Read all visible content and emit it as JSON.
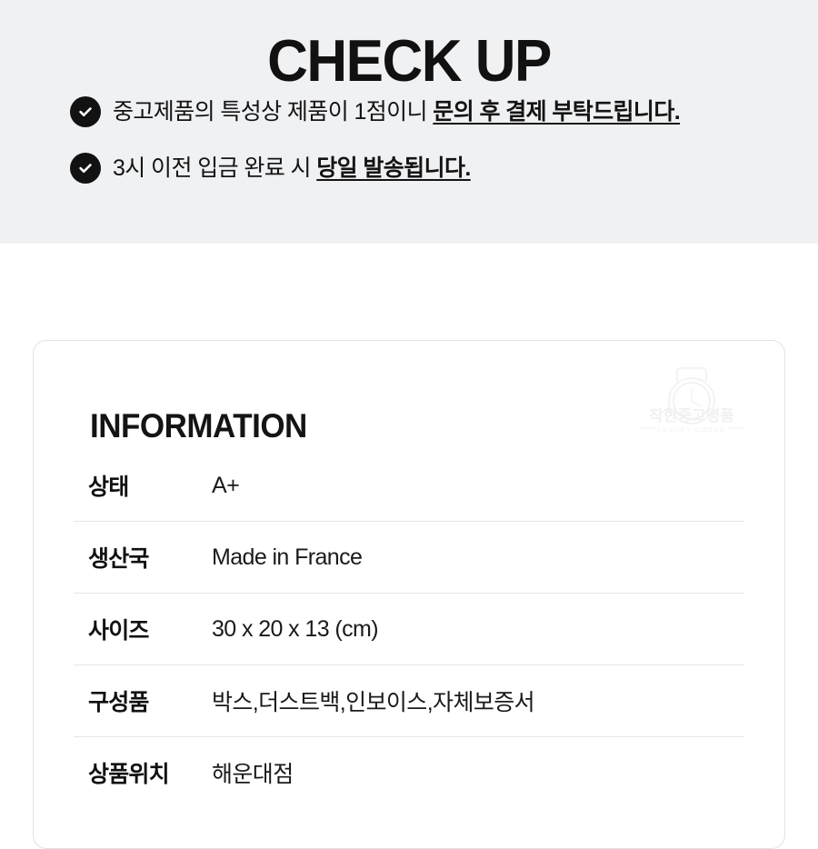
{
  "header": {
    "title": "CHECK UP",
    "background_color": "#f0f1f3",
    "notices": [
      {
        "icon": "check-circle-icon",
        "text_plain": "중고제품의 특성상 제품이 1점이니 ",
        "text_emphasis": "문의 후 결제 부탁드립니다."
      },
      {
        "icon": "check-circle-icon",
        "text_plain": "3시 이전 입금 완료 시 ",
        "text_emphasis": "당일 발송됩니다."
      }
    ]
  },
  "information": {
    "heading": "INFORMATION",
    "watermark": {
      "icon": "watch-logo-icon",
      "brand_ko": "착한중고명품",
      "brand_en": "LUXURY GOODS",
      "color": "#f1f1f1"
    },
    "rows": [
      {
        "label": "상태",
        "value": "A+"
      },
      {
        "label": "생산국",
        "value": "Made in France"
      },
      {
        "label": "사이즈",
        "value": "30 x 20 x 13 (cm)"
      },
      {
        "label": "구성품",
        "value": "박스,더스트백,인보이스,자체보증서"
      },
      {
        "label": "상품위치",
        "value": "해운대점"
      }
    ]
  },
  "colors": {
    "text_primary": "#141414",
    "band_bg": "#f0f1f3",
    "card_border": "#e3e3e5",
    "row_divider": "#e6e6e8",
    "icon_fill": "#121212"
  }
}
